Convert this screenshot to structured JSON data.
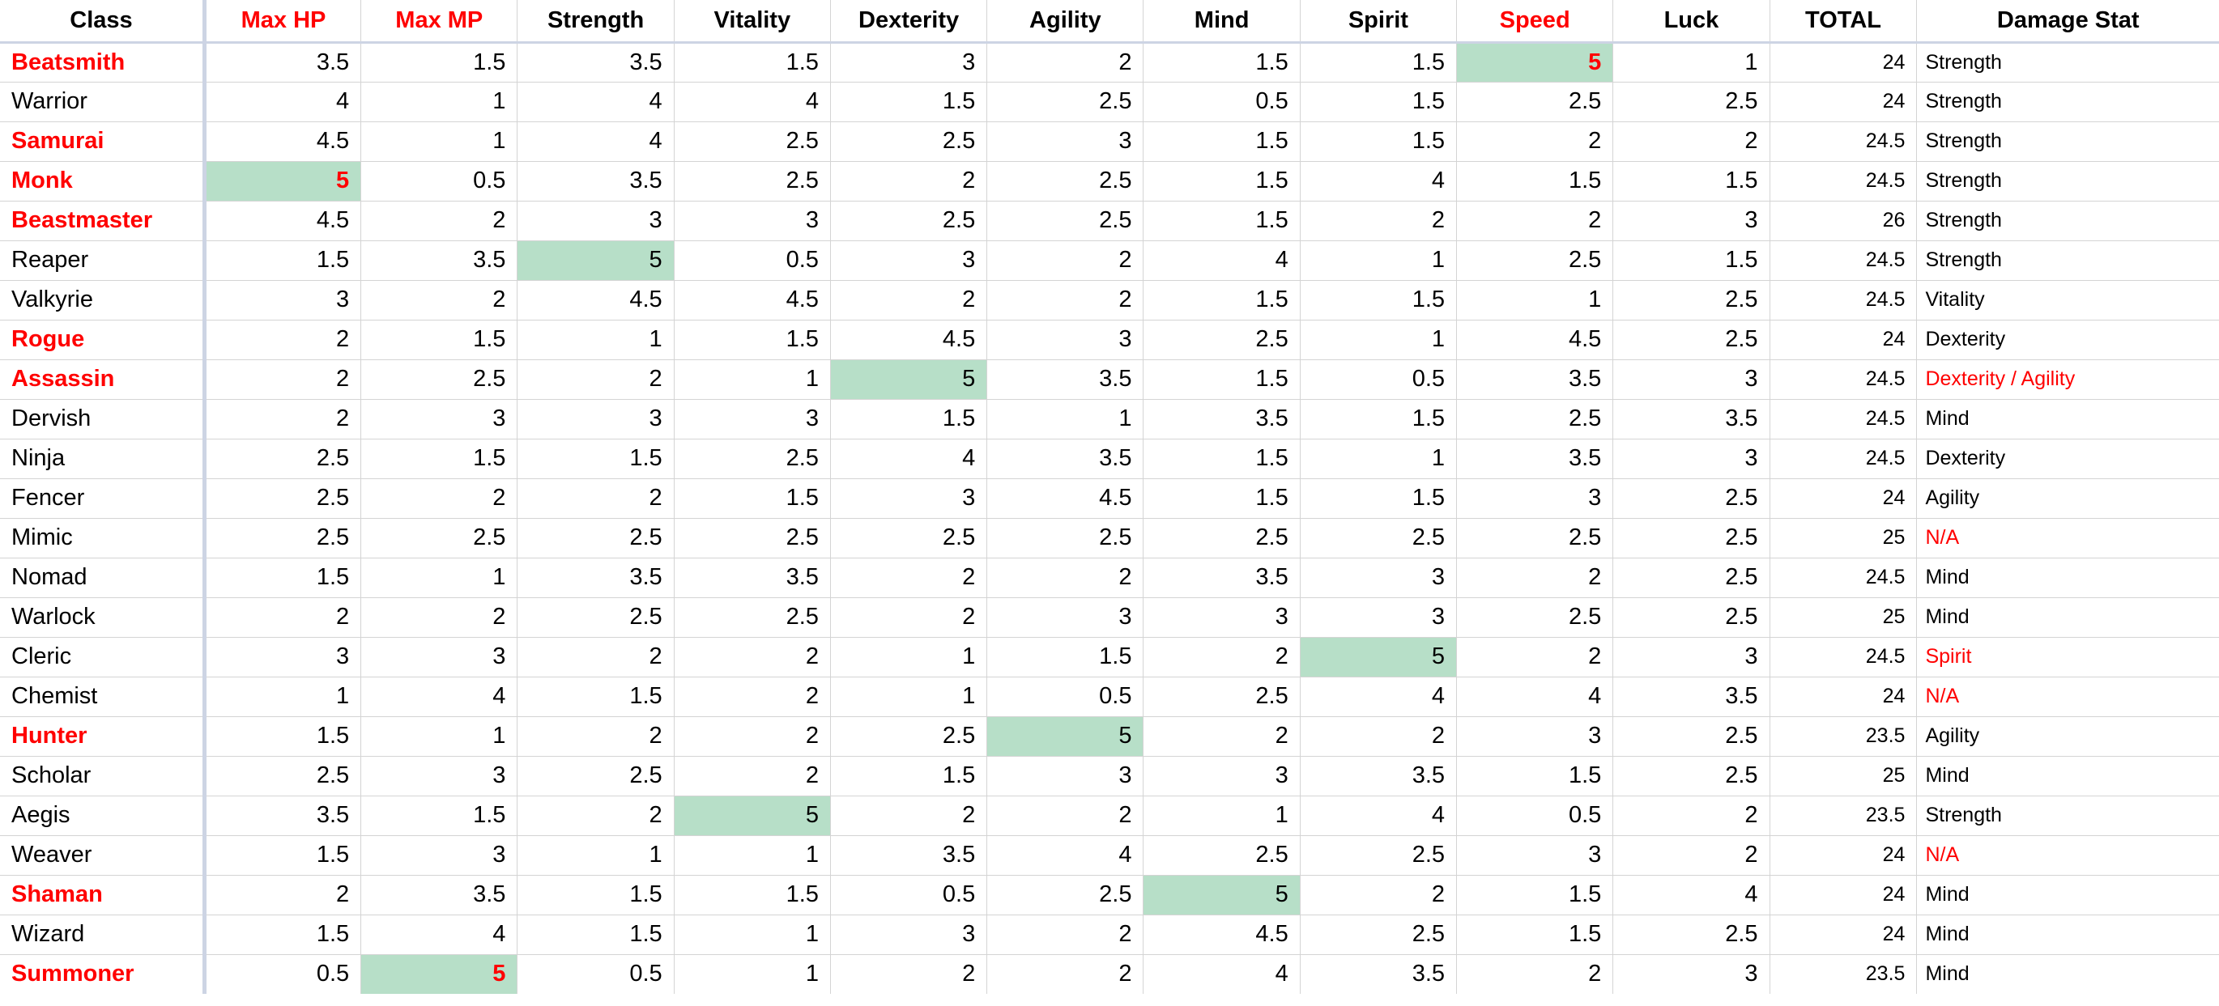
{
  "table": {
    "headers": [
      {
        "label": "Class",
        "color": "#000000"
      },
      {
        "label": "Max HP",
        "color": "#ff0000"
      },
      {
        "label": "Max MP",
        "color": "#ff0000"
      },
      {
        "label": "Strength",
        "color": "#000000"
      },
      {
        "label": "Vitality",
        "color": "#000000"
      },
      {
        "label": "Dexterity",
        "color": "#000000"
      },
      {
        "label": "Agility",
        "color": "#000000"
      },
      {
        "label": "Mind",
        "color": "#000000"
      },
      {
        "label": "Spirit",
        "color": "#000000"
      },
      {
        "label": "Speed",
        "color": "#ff0000"
      },
      {
        "label": "Luck",
        "color": "#000000"
      },
      {
        "label": "TOTAL",
        "color": "#000000"
      },
      {
        "label": "Damage Stat",
        "color": "#000000"
      }
    ],
    "colors": {
      "highlight_green": "#b7dfc8",
      "accent_red": "#ff0000",
      "grid_line": "#d4d4d4",
      "freeze_divider": "#cdd4e4"
    },
    "rows": [
      {
        "class": "Beatsmith",
        "class_red": true,
        "stats": [
          "3.5",
          "1.5",
          "3.5",
          "1.5",
          "3",
          "2",
          "1.5",
          "1.5",
          "5",
          "1"
        ],
        "highlight": 8,
        "highlight_red": true,
        "total": "24",
        "damage": "Strength",
        "damage_red": false
      },
      {
        "class": "Warrior",
        "class_red": false,
        "stats": [
          "4",
          "1",
          "4",
          "4",
          "1.5",
          "2.5",
          "0.5",
          "1.5",
          "2.5",
          "2.5"
        ],
        "highlight": -1,
        "highlight_red": false,
        "total": "24",
        "damage": "Strength",
        "damage_red": false
      },
      {
        "class": "Samurai",
        "class_red": true,
        "stats": [
          "4.5",
          "1",
          "4",
          "2.5",
          "2.5",
          "3",
          "1.5",
          "1.5",
          "2",
          "2"
        ],
        "highlight": -1,
        "highlight_red": false,
        "total": "24.5",
        "damage": "Strength",
        "damage_red": false
      },
      {
        "class": "Monk",
        "class_red": true,
        "stats": [
          "5",
          "0.5",
          "3.5",
          "2.5",
          "2",
          "2.5",
          "1.5",
          "4",
          "1.5",
          "1.5"
        ],
        "highlight": 0,
        "highlight_red": true,
        "total": "24.5",
        "damage": "Strength",
        "damage_red": false
      },
      {
        "class": "Beastmaster",
        "class_red": true,
        "stats": [
          "4.5",
          "2",
          "3",
          "3",
          "2.5",
          "2.5",
          "1.5",
          "2",
          "2",
          "3"
        ],
        "highlight": -1,
        "highlight_red": false,
        "total": "26",
        "damage": "Strength",
        "damage_red": false
      },
      {
        "class": "Reaper",
        "class_red": false,
        "stats": [
          "1.5",
          "3.5",
          "5",
          "0.5",
          "3",
          "2",
          "4",
          "1",
          "2.5",
          "1.5"
        ],
        "highlight": 2,
        "highlight_red": false,
        "total": "24.5",
        "damage": "Strength",
        "damage_red": false
      },
      {
        "class": "Valkyrie",
        "class_red": false,
        "stats": [
          "3",
          "2",
          "4.5",
          "4.5",
          "2",
          "2",
          "1.5",
          "1.5",
          "1",
          "2.5"
        ],
        "highlight": -1,
        "highlight_red": false,
        "total": "24.5",
        "damage": "Vitality",
        "damage_red": false
      },
      {
        "class": "Rogue",
        "class_red": true,
        "stats": [
          "2",
          "1.5",
          "1",
          "1.5",
          "4.5",
          "3",
          "2.5",
          "1",
          "4.5",
          "2.5"
        ],
        "highlight": -1,
        "highlight_red": false,
        "total": "24",
        "damage": "Dexterity",
        "damage_red": false
      },
      {
        "class": "Assassin",
        "class_red": true,
        "stats": [
          "2",
          "2.5",
          "2",
          "1",
          "5",
          "3.5",
          "1.5",
          "0.5",
          "3.5",
          "3"
        ],
        "highlight": 4,
        "highlight_red": false,
        "total": "24.5",
        "damage": "Dexterity / Agility",
        "damage_red": true
      },
      {
        "class": "Dervish",
        "class_red": false,
        "stats": [
          "2",
          "3",
          "3",
          "3",
          "1.5",
          "1",
          "3.5",
          "1.5",
          "2.5",
          "3.5"
        ],
        "highlight": -1,
        "highlight_red": false,
        "total": "24.5",
        "damage": "Mind",
        "damage_red": false
      },
      {
        "class": "Ninja",
        "class_red": false,
        "stats": [
          "2.5",
          "1.5",
          "1.5",
          "2.5",
          "4",
          "3.5",
          "1.5",
          "1",
          "3.5",
          "3"
        ],
        "highlight": -1,
        "highlight_red": false,
        "total": "24.5",
        "damage": "Dexterity",
        "damage_red": false
      },
      {
        "class": "Fencer",
        "class_red": false,
        "stats": [
          "2.5",
          "2",
          "2",
          "1.5",
          "3",
          "4.5",
          "1.5",
          "1.5",
          "3",
          "2.5"
        ],
        "highlight": -1,
        "highlight_red": false,
        "total": "24",
        "damage": "Agility",
        "damage_red": false
      },
      {
        "class": "Mimic",
        "class_red": false,
        "stats": [
          "2.5",
          "2.5",
          "2.5",
          "2.5",
          "2.5",
          "2.5",
          "2.5",
          "2.5",
          "2.5",
          "2.5"
        ],
        "highlight": -1,
        "highlight_red": false,
        "total": "25",
        "damage": "N/A",
        "damage_red": true
      },
      {
        "class": "Nomad",
        "class_red": false,
        "stats": [
          "1.5",
          "1",
          "3.5",
          "3.5",
          "2",
          "2",
          "3.5",
          "3",
          "2",
          "2.5"
        ],
        "highlight": -1,
        "highlight_red": false,
        "total": "24.5",
        "damage": "Mind",
        "damage_red": false
      },
      {
        "class": "Warlock",
        "class_red": false,
        "stats": [
          "2",
          "2",
          "2.5",
          "2.5",
          "2",
          "3",
          "3",
          "3",
          "2.5",
          "2.5"
        ],
        "highlight": -1,
        "highlight_red": false,
        "total": "25",
        "damage": "Mind",
        "damage_red": false
      },
      {
        "class": "Cleric",
        "class_red": false,
        "stats": [
          "3",
          "3",
          "2",
          "2",
          "1",
          "1.5",
          "2",
          "5",
          "2",
          "3"
        ],
        "highlight": 7,
        "highlight_red": false,
        "total": "24.5",
        "damage": "Spirit",
        "damage_red": true
      },
      {
        "class": "Chemist",
        "class_red": false,
        "stats": [
          "1",
          "4",
          "1.5",
          "2",
          "1",
          "0.5",
          "2.5",
          "4",
          "4",
          "3.5"
        ],
        "highlight": -1,
        "highlight_red": false,
        "total": "24",
        "damage": "N/A",
        "damage_red": true
      },
      {
        "class": "Hunter",
        "class_red": true,
        "stats": [
          "1.5",
          "1",
          "2",
          "2",
          "2.5",
          "5",
          "2",
          "2",
          "3",
          "2.5"
        ],
        "highlight": 5,
        "highlight_red": false,
        "total": "23.5",
        "damage": "Agility",
        "damage_red": false
      },
      {
        "class": "Scholar",
        "class_red": false,
        "stats": [
          "2.5",
          "3",
          "2.5",
          "2",
          "1.5",
          "3",
          "3",
          "3.5",
          "1.5",
          "2.5"
        ],
        "highlight": -1,
        "highlight_red": false,
        "total": "25",
        "damage": "Mind",
        "damage_red": false
      },
      {
        "class": "Aegis",
        "class_red": false,
        "stats": [
          "3.5",
          "1.5",
          "2",
          "5",
          "2",
          "2",
          "1",
          "4",
          "0.5",
          "2"
        ],
        "highlight": 3,
        "highlight_red": false,
        "total": "23.5",
        "damage": "Strength",
        "damage_red": false
      },
      {
        "class": "Weaver",
        "class_red": false,
        "stats": [
          "1.5",
          "3",
          "1",
          "1",
          "3.5",
          "4",
          "2.5",
          "2.5",
          "3",
          "2"
        ],
        "highlight": -1,
        "highlight_red": false,
        "total": "24",
        "damage": "N/A",
        "damage_red": true
      },
      {
        "class": "Shaman",
        "class_red": true,
        "stats": [
          "2",
          "3.5",
          "1.5",
          "1.5",
          "0.5",
          "2.5",
          "5",
          "2",
          "1.5",
          "4"
        ],
        "highlight": 6,
        "highlight_red": false,
        "total": "24",
        "damage": "Mind",
        "damage_red": false
      },
      {
        "class": "Wizard",
        "class_red": false,
        "stats": [
          "1.5",
          "4",
          "1.5",
          "1",
          "3",
          "2",
          "4.5",
          "2.5",
          "1.5",
          "2.5"
        ],
        "highlight": -1,
        "highlight_red": false,
        "total": "24",
        "damage": "Mind",
        "damage_red": false
      },
      {
        "class": "Summoner",
        "class_red": true,
        "stats": [
          "0.5",
          "5",
          "0.5",
          "1",
          "2",
          "2",
          "4",
          "3.5",
          "2",
          "3"
        ],
        "highlight": 1,
        "highlight_red": true,
        "total": "23.5",
        "damage": "Mind",
        "damage_red": false
      }
    ]
  }
}
